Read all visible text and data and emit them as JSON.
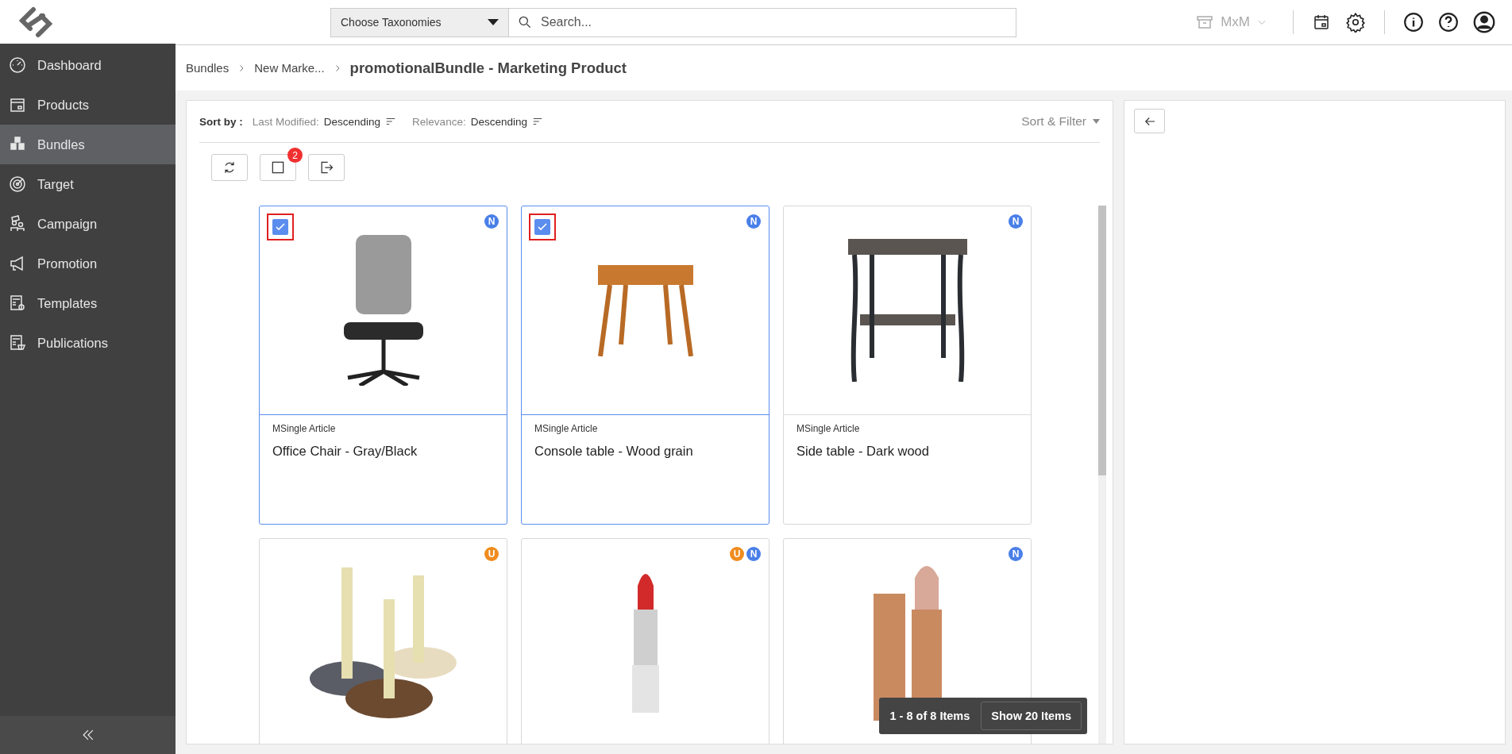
{
  "header": {
    "taxonomy_dropdown": "Choose Taxonomies",
    "search": {
      "placeholder": "Search..."
    },
    "workspace": "MxM"
  },
  "sidebar": {
    "items": [
      {
        "label": "Dashboard",
        "selected": false
      },
      {
        "label": "Products",
        "selected": false
      },
      {
        "label": "Bundles",
        "selected": true
      },
      {
        "label": "Target",
        "selected": false
      },
      {
        "label": "Campaign",
        "selected": false
      },
      {
        "label": "Promotion",
        "selected": false
      },
      {
        "label": "Templates",
        "selected": false
      },
      {
        "label": "Publications",
        "selected": false
      }
    ]
  },
  "breadcrumb": [
    "Bundles",
    "New Marke...",
    "promotionalBundle - Marketing Product"
  ],
  "sort_bar": {
    "label": "Sort by :",
    "sorts": [
      {
        "field": "Last Modified:",
        "order": "Descending"
      },
      {
        "field": "Relevance:",
        "order": "Descending"
      }
    ],
    "filter_button": "Sort & Filter"
  },
  "toolbar": {
    "selection_count": "2"
  },
  "cards": [
    {
      "type": "MSingle Article",
      "name": "Office Chair - Gray/Black",
      "checked": true,
      "badges": [
        {
          "label": "N",
          "color": "#4a7fe8"
        }
      ]
    },
    {
      "type": "MSingle Article",
      "name": "Console table - Wood grain",
      "checked": true,
      "badges": [
        {
          "label": "N",
          "color": "#4a7fe8"
        }
      ]
    },
    {
      "type": "MSingle Article",
      "name": "Side table - Dark wood",
      "checked": false,
      "badges": [
        {
          "label": "N",
          "color": "#4a7fe8"
        }
      ]
    },
    {
      "checked": false,
      "badges": [
        {
          "label": "U",
          "color": "#f08c1e"
        }
      ]
    },
    {
      "checked": false,
      "badges": [
        {
          "label": "U",
          "color": "#f08c1e"
        },
        {
          "label": "N",
          "color": "#4a7fe8"
        }
      ]
    },
    {
      "checked": false,
      "badges": [
        {
          "label": "N",
          "color": "#4a7fe8"
        }
      ]
    }
  ],
  "pagination": {
    "range": "1 - 8 of 8 Items",
    "button": "Show 20 Items"
  }
}
